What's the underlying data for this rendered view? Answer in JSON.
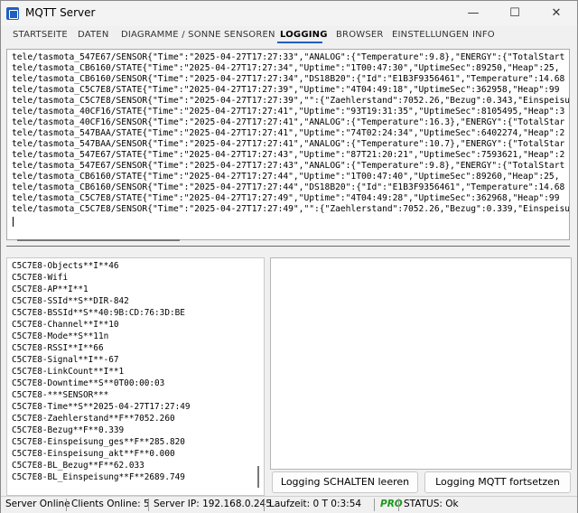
{
  "window": {
    "title": "MQTT Server",
    "minimize": "—",
    "maximize": "☐",
    "close": "✕"
  },
  "tabs": [
    "STARTSEITE",
    "DATEN",
    "DIAGRAMME / SONNE",
    "SENSOREN",
    "LOGGING",
    "BROWSER",
    "EINSTELLUNGEN",
    "INFO"
  ],
  "active_tab": "LOGGING",
  "log_lines": [
    "tele/tasmota_547E67/SENSOR{\"Time\":\"2025-04-27T17:27:33\",\"ANALOG\":{\"Temperature\":9.8},\"ENERGY\":{\"TotalStart",
    "tele/tasmota_CB6160/STATE{\"Time\":\"2025-04-27T17:27:34\",\"Uptime\":\"1T00:47:30\",\"UptimeSec\":89250,\"Heap\":25,",
    "tele/tasmota_CB6160/SENSOR{\"Time\":\"2025-04-27T17:27:34\",\"DS18B20\":{\"Id\":\"E1B3F9356461\",\"Temperature\":14.68",
    "tele/tasmota_C5C7E8/STATE{\"Time\":\"2025-04-27T17:27:39\",\"Uptime\":\"4T04:49:18\",\"UptimeSec\":362958,\"Heap\":99",
    "tele/tasmota_C5C7E8/SENSOR{\"Time\":\"2025-04-27T17:27:39\",\"\":{\"Zaehlerstand\":7052.26,\"Bezug\":0.343,\"Einspeisu",
    "tele/tasmota_40CF16/STATE{\"Time\":\"2025-04-27T17:27:41\",\"Uptime\":\"93T19:31:35\",\"UptimeSec\":8105495,\"Heap\":3",
    "tele/tasmota_40CF16/SENSOR{\"Time\":\"2025-04-27T17:27:41\",\"ANALOG\":{\"Temperature\":16.3},\"ENERGY\":{\"TotalStar",
    "tele/tasmota_547BAA/STATE{\"Time\":\"2025-04-27T17:27:41\",\"Uptime\":\"74T02:24:34\",\"UptimeSec\":6402274,\"Heap\":2",
    "tele/tasmota_547BAA/SENSOR{\"Time\":\"2025-04-27T17:27:41\",\"ANALOG\":{\"Temperature\":10.7},\"ENERGY\":{\"TotalStar",
    "tele/tasmota_547E67/STATE{\"Time\":\"2025-04-27T17:27:43\",\"Uptime\":\"87T21:20:21\",\"UptimeSec\":7593621,\"Heap\":2",
    "tele/tasmota_547E67/SENSOR{\"Time\":\"2025-04-27T17:27:43\",\"ANALOG\":{\"Temperature\":9.8},\"ENERGY\":{\"TotalStart",
    "tele/tasmota_CB6160/STATE{\"Time\":\"2025-04-27T17:27:44\",\"Uptime\":\"1T00:47:40\",\"UptimeSec\":89260,\"Heap\":25,",
    "tele/tasmota_CB6160/SENSOR{\"Time\":\"2025-04-27T17:27:44\",\"DS18B20\":{\"Id\":\"E1B3F9356461\",\"Temperature\":14.68",
    "tele/tasmota_C5C7E8/STATE{\"Time\":\"2025-04-27T17:27:49\",\"Uptime\":\"4T04:49:28\",\"UptimeSec\":362968,\"Heap\":99",
    "tele/tasmota_C5C7E8/SENSOR{\"Time\":\"2025-04-27T17:27:49\",\"\":{\"Zaehlerstand\":7052.26,\"Bezug\":0.339,\"Einspeisu"
  ],
  "var_lines": [
    "C5C7E8-Objects**I**46",
    "C5C7E8-Wifi",
    "C5C7E8-AP**I**1",
    "C5C7E8-SSId**S**DIR-842",
    "C5C7E8-BSSId**S**40:9B:CD:76:3D:BE",
    "C5C7E8-Channel**I**10",
    "C5C7E8-Mode**S**11n",
    "C5C7E8-RSSI**I**66",
    "C5C7E8-Signal**I**-67",
    "C5C7E8-LinkCount**I**1",
    "C5C7E8-Downtime**S**0T00:00:03",
    "C5C7E8-***SENSOR***",
    "C5C7E8-Time**S**2025-04-27T17:27:49",
    "C5C7E8-Zaehlerstand**F**7052.260",
    "C5C7E8-Bezug**F**0.339",
    "C5C7E8-Einspeisung_ges**F**285.820",
    "C5C7E8-Einspeisung_akt**F**0.000",
    "C5C7E8-BL_Bezug**F**62.033",
    "C5C7E8-BL_Einspeisung**F**2689.749"
  ],
  "buttons": {
    "clear": "Logging SCHALTEN leeren",
    "resume": "Logging MQTT fortsetzen"
  },
  "status": {
    "server": "Server Online",
    "clients": "Clients Online: 5",
    "ip": "Server IP: 192.168.0.245",
    "uptime": "Laufzeit: 0 T 0:3:54",
    "pro": "PRO",
    "status": "STATUS: Ok"
  },
  "colors": {
    "accent": "#1f5fbf",
    "pro": "#1a9a1a"
  }
}
